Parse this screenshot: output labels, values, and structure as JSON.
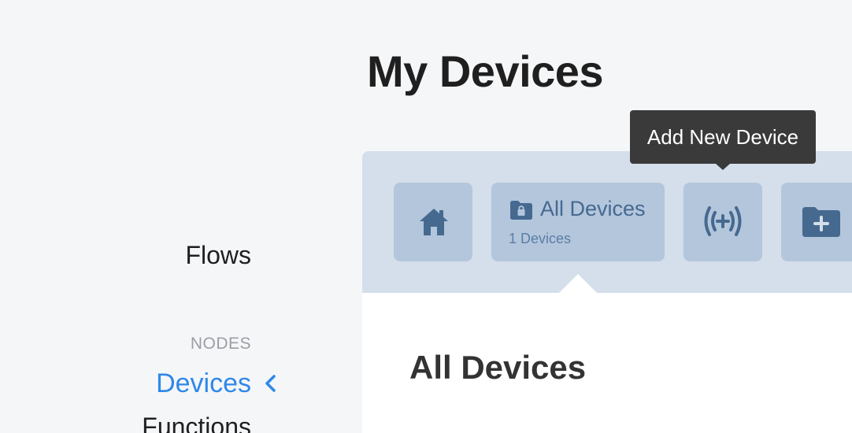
{
  "page": {
    "title": "My Devices"
  },
  "sidebar": {
    "flows_label": "Flows",
    "section_heading": "NODES",
    "items": [
      {
        "label": "Devices",
        "active": true
      },
      {
        "label": "Functions",
        "active": false
      }
    ],
    "active_color": "#2e88e8"
  },
  "toolbar": {
    "home_icon": "home-icon",
    "all_devices": {
      "icon": "locked-folder-icon",
      "label": "All Devices",
      "count": "1 Devices"
    },
    "add_device_icon": "broadcast-plus-icon",
    "add_folder_icon": "folder-plus-icon",
    "tooltip": "Add New Device"
  },
  "content": {
    "title": "All Devices"
  },
  "colors": {
    "panel_bg": "#d4dfeb",
    "tile_bg": "#b3c6dc",
    "icon": "#46698f",
    "tooltip_bg": "#3a3a3a"
  }
}
